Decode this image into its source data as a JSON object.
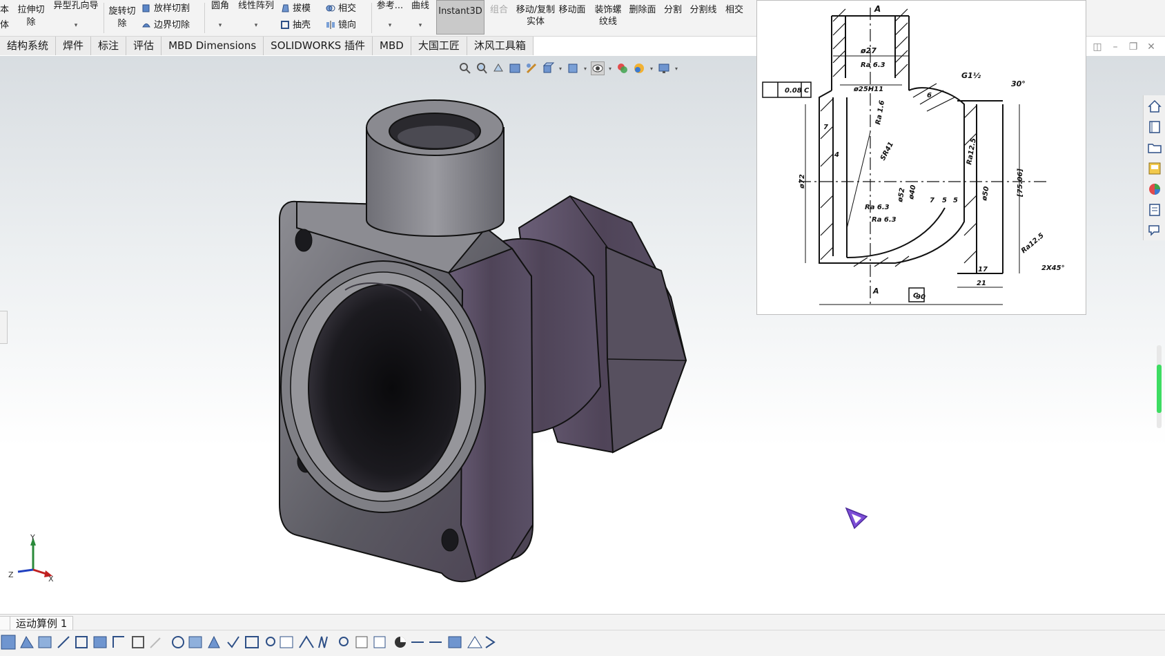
{
  "ribbon": {
    "left_cut_top": "本",
    "left_cut_bottom": "体",
    "extrude_cut": "拉伸切除",
    "hole_wizard": "异型孔向导",
    "revolve_cut": "旋转切除",
    "loft_cut": "放样切割",
    "boundary_cut": "边界切除",
    "fillet": "圆角",
    "linear_pattern": "线性阵列",
    "draft": "拔模",
    "intersect": "相交",
    "shell": "抽壳",
    "mirror": "镜向",
    "reference": "参考...",
    "curves": "曲线",
    "instant3d": "Instant3D",
    "combine": "组合",
    "move_copy_body": "移动/复制实体",
    "move_face": "移动面",
    "cosmetic_thread": "装饰螺纹线",
    "delete_face": "删除面",
    "split": "分割",
    "split_line": "分割线",
    "intersect2": "相交"
  },
  "tabs": [
    "结构系统",
    "焊件",
    "标注",
    "评估",
    "MBD Dimensions",
    "SOLIDWORKS 插件",
    "MBD",
    "大国工匠",
    "沐风工具箱"
  ],
  "drawing": {
    "labels": {
      "a_top": "A",
      "d27": "ø27",
      "ra63_top": "Ra 6.3",
      "flatness": "0.08",
      "datum_c": "C",
      "d25h11": "ø25H11",
      "thread": "G1½",
      "angle30": "30°",
      "ra16": "Ra 1.6",
      "sr41": "SR41",
      "ra125_a": "Ra12.5",
      "d50": "ø50",
      "d72": "ø72",
      "d52": "ø52",
      "d40": "ø40",
      "dim7": "7",
      "dim4": "4",
      "dim75": "[75.06]",
      "dim7b": "7",
      "dim5a": "5",
      "dim5b": "5",
      "ra63_a": "Ra 6.3",
      "ra63_b": "Ra 6.3",
      "ra125_b": "Ra12.5",
      "chamfer": "2X45°",
      "dim17": "17",
      "dim21": "21",
      "dim90": "90",
      "a_bot": "A",
      "c_bot": "C",
      "dim6": "6"
    }
  },
  "bottom": {
    "tab_left": "",
    "tab_motion": "运动算例 1"
  },
  "axes": {
    "x": "X",
    "y": "Y",
    "z": "Z"
  },
  "colors": {
    "part_face": "#6b6b72",
    "part_purple": "#5a4a66",
    "part_edge": "#111111",
    "accent_blue": "#2b6cc4",
    "scroll_green": "#3ddc62",
    "cursor_purple": "#7c4dd6"
  }
}
